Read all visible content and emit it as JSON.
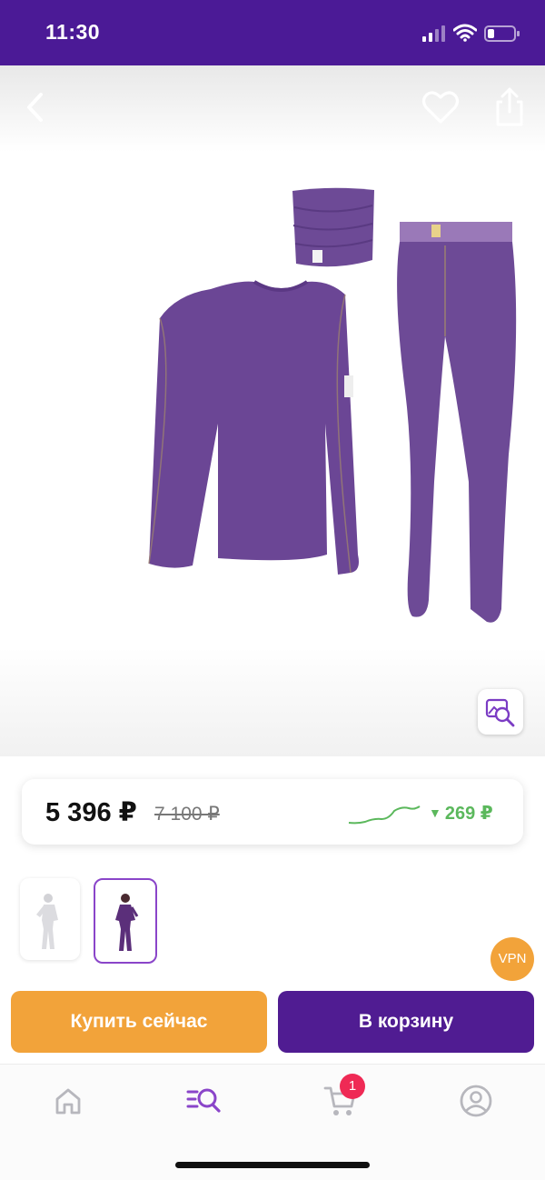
{
  "status_bar": {
    "time": "11:30"
  },
  "toolbar": {
    "back_icon": "chevron-left-icon",
    "favorite_icon": "heart-outline-icon",
    "share_icon": "share-icon"
  },
  "hero": {
    "image_search_icon": "image-search-icon"
  },
  "price": {
    "current": "5 396 ₽",
    "old": "7 100 ₽",
    "drop": "269 ₽",
    "drop_arrow": "▼",
    "trend_color": "#5bb85c"
  },
  "thumbnails": {
    "count": 2,
    "selected": 2
  },
  "vpn_badge": "VPN",
  "actions": {
    "buy_now": "Купить сейчас",
    "add_to_cart": "В корзину"
  },
  "tab_bar": {
    "items": [
      {
        "name": "home",
        "icon": "home-icon"
      },
      {
        "name": "catalog",
        "icon": "catalog-search-icon",
        "active": true
      },
      {
        "name": "cart",
        "icon": "cart-icon"
      },
      {
        "name": "profile",
        "icon": "profile-icon"
      }
    ],
    "cart_count": "1"
  },
  "colors": {
    "brand": "#4b1a96",
    "accent_orange": "#f2a33a",
    "cart_badge": "#ef2a55",
    "active_tab": "#8a45c9",
    "inactive_tab": "#b7b7bd"
  }
}
